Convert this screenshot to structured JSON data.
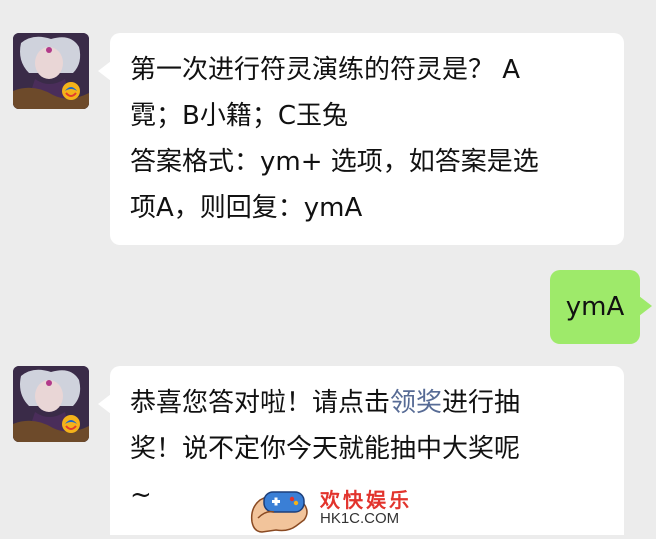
{
  "messages": [
    {
      "sender": "bot",
      "lines": [
        "第一次进行符灵演练的符灵是？ A",
        "霓；B小籍；C玉兔",
        "答案格式：ym+ 选项，如答案是选",
        "项A，则回复：ymA"
      ]
    },
    {
      "sender": "user",
      "text": "ymA"
    },
    {
      "sender": "bot",
      "line1_before": "恭喜您答对啦！请点击",
      "line1_link": "领奖",
      "line1_after": "进行抽",
      "line2": "奖！说不定你今天就能抽中大奖呢",
      "line3": "~"
    }
  ],
  "watermark": {
    "name": "欢快娱乐",
    "site": "HK1C.COM"
  },
  "colors": {
    "background": "#ececec",
    "bubble_white": "#ffffff",
    "bubble_green": "#9eea6a",
    "link": "#576b95",
    "watermark_red": "#e2342d"
  },
  "icons": {
    "avatar": "game-character-avatar-icon",
    "avatar_badge": "tencent-games-logo-icon",
    "watermark_logo": "hand-holding-gamepad-icon"
  }
}
